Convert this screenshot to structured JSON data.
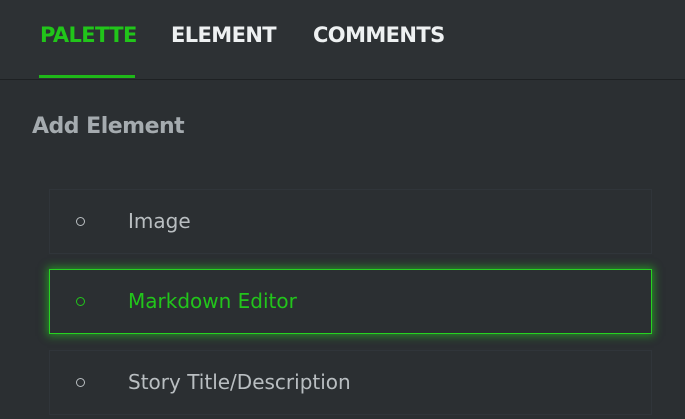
{
  "tabs": [
    {
      "label": "PALETTE",
      "active": true
    },
    {
      "label": "ELEMENT",
      "active": false
    },
    {
      "label": "COMMENTS",
      "active": false
    }
  ],
  "section": {
    "title": "Add Element"
  },
  "elements": [
    {
      "label": "Image",
      "selected": false
    },
    {
      "label": "Markdown Editor",
      "selected": true
    },
    {
      "label": "Story Title/Description",
      "selected": false
    }
  ],
  "colors": {
    "accent": "#21c51a",
    "background": "#2b2f32",
    "text_muted": "#b9bec1"
  }
}
